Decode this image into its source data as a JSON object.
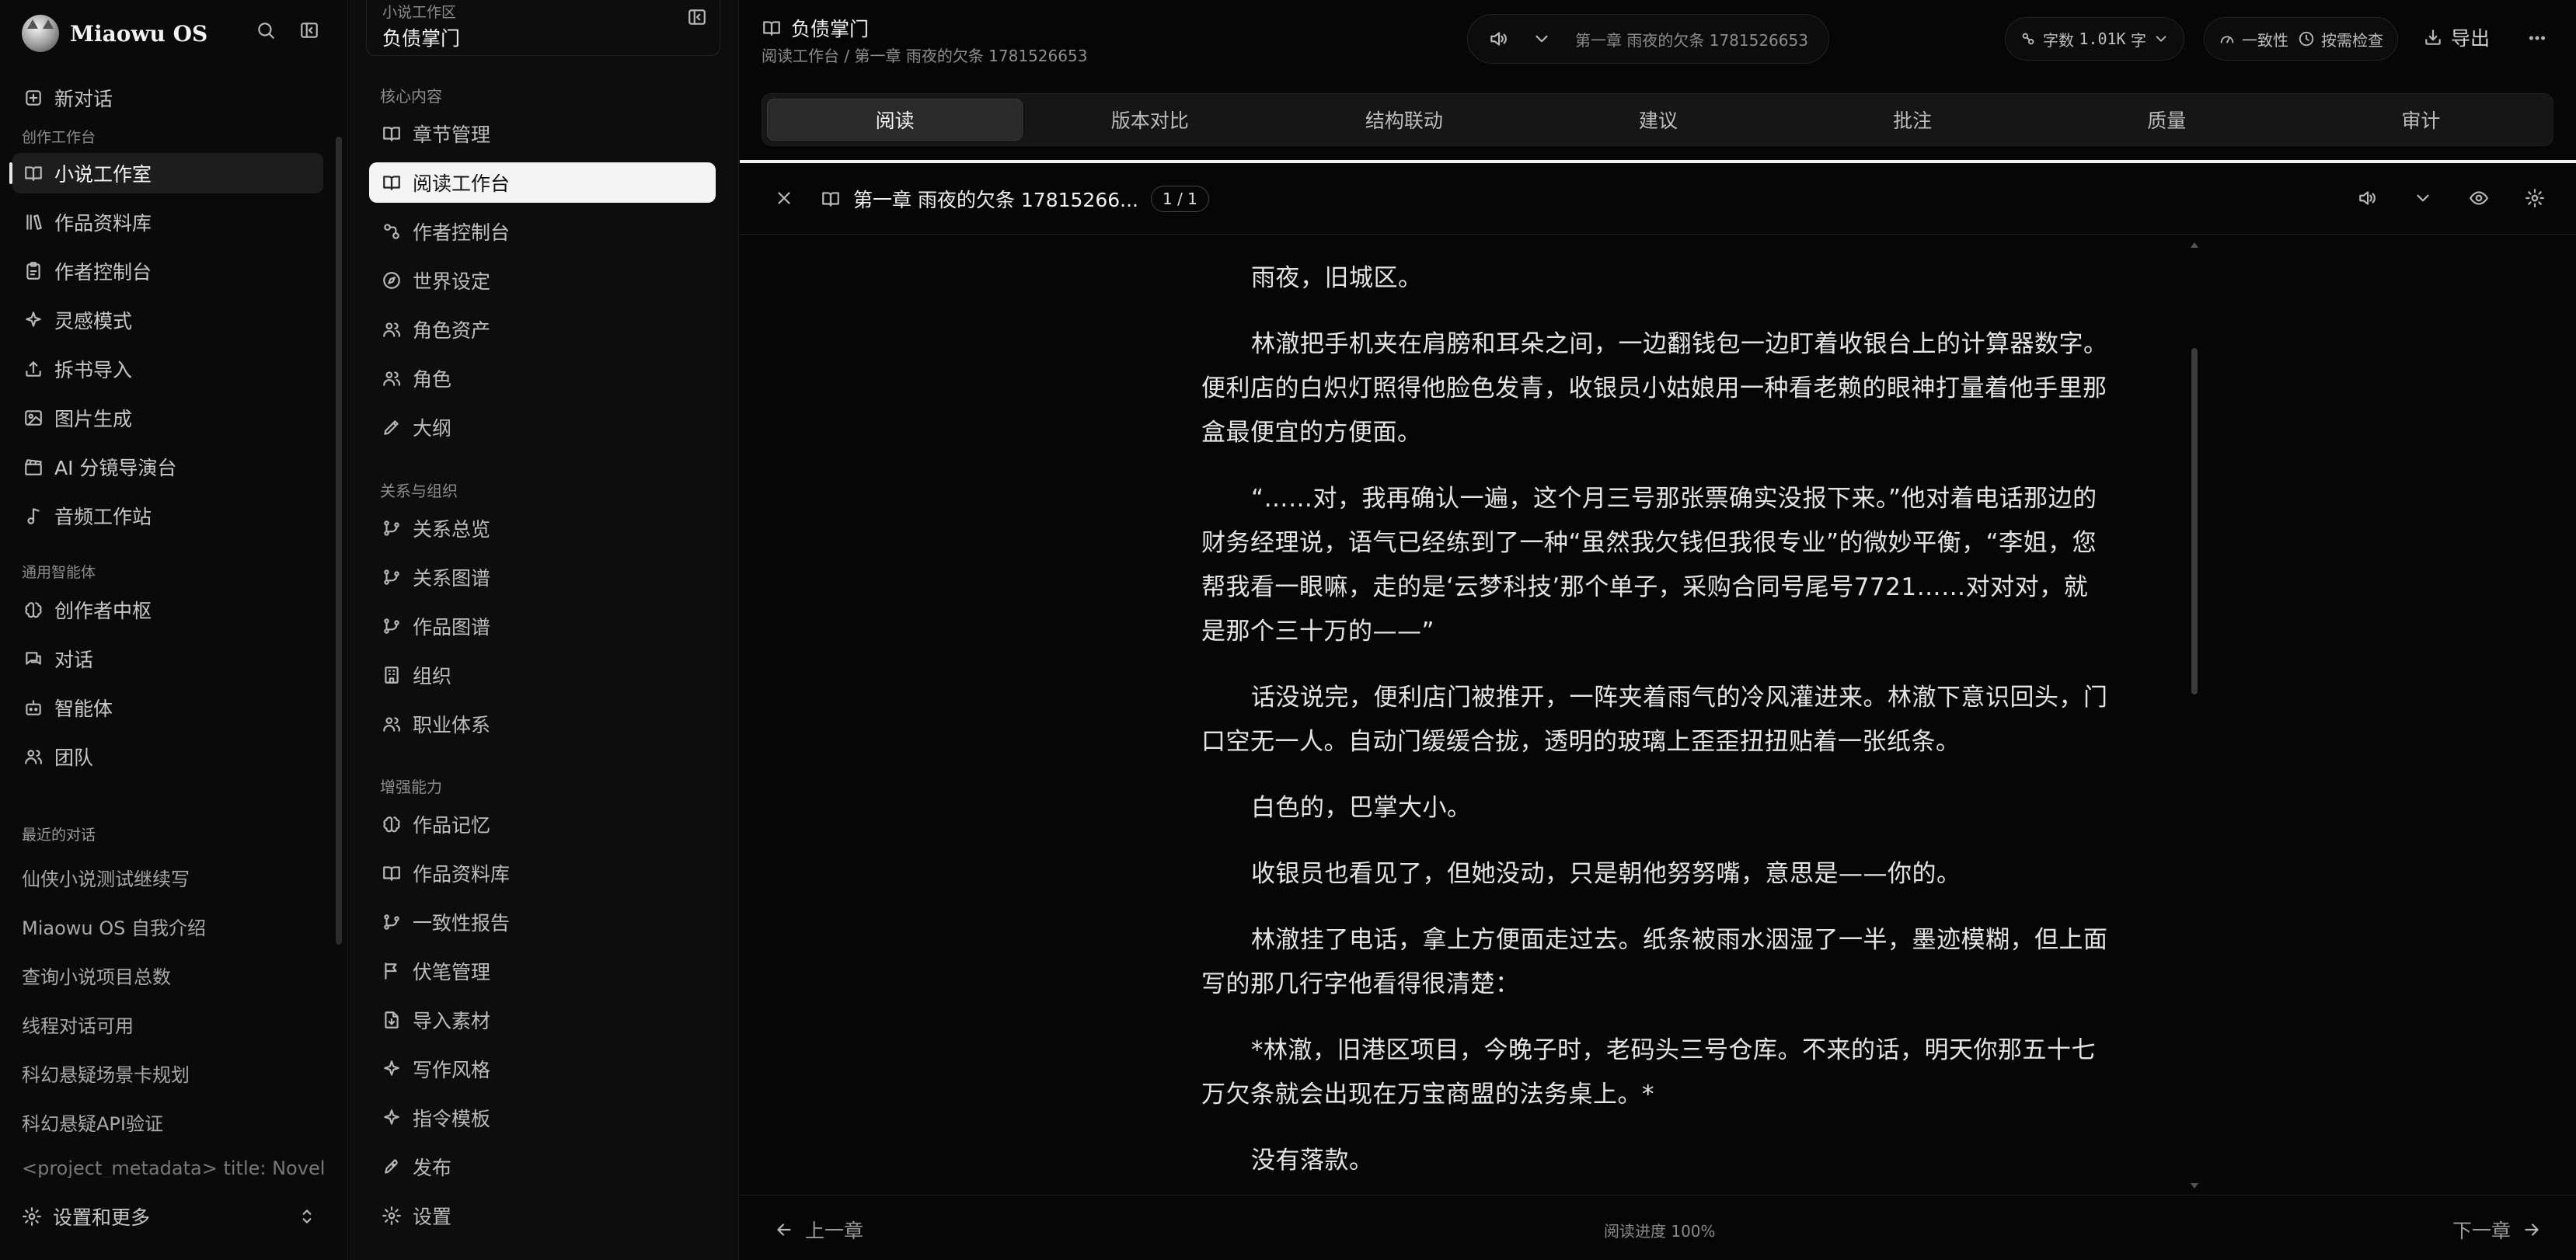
{
  "app": {
    "name": "Miaowu OS"
  },
  "sidebar": {
    "new_chat": "新对话",
    "section_create": "创作工作台",
    "create_items": [
      {
        "label": "小说工作室",
        "icon": "book-open-icon",
        "active": true
      },
      {
        "label": "作品资料库",
        "icon": "library-icon"
      },
      {
        "label": "作者控制台",
        "icon": "clipboard-icon"
      },
      {
        "label": "灵感模式",
        "icon": "sparkle-icon"
      },
      {
        "label": "拆书导入",
        "icon": "upload-icon"
      },
      {
        "label": "图片生成",
        "icon": "image-icon"
      },
      {
        "label": "AI 分镜导演台",
        "icon": "clapperboard-icon"
      },
      {
        "label": "音频工作站",
        "icon": "music-icon"
      }
    ],
    "section_agents": "通用智能体",
    "agent_items": [
      {
        "label": "创作者中枢",
        "icon": "brain-icon"
      },
      {
        "label": "对话",
        "icon": "chat-icon"
      },
      {
        "label": "智能体",
        "icon": "bot-icon"
      },
      {
        "label": "团队",
        "icon": "team-icon"
      }
    ],
    "section_recent": "最近的对话",
    "recent": [
      "仙侠小说测试继续写",
      "Miaowu OS 自我介绍",
      "查询小说项目总数",
      "线程对话可用",
      "科幻悬疑场景卡规划",
      "科幻悬疑API验证",
      "<project_metadata> title: Novel To..."
    ],
    "settings_label": "设置和更多"
  },
  "panel2": {
    "sub": "小说工作区",
    "title": "负债掌门",
    "section_core": "核心内容",
    "core_items": [
      {
        "label": "章节管理",
        "icon": "book-icon"
      },
      {
        "label": "阅读工作台",
        "icon": "book-open-icon",
        "active": true
      },
      {
        "label": "作者控制台",
        "icon": "nodes-icon"
      },
      {
        "label": "世界设定",
        "icon": "compass-icon"
      },
      {
        "label": "角色资产",
        "icon": "users-icon"
      },
      {
        "label": "角色",
        "icon": "users-icon"
      },
      {
        "label": "大纲",
        "icon": "pencil-icon"
      }
    ],
    "section_relations": "关系与组织",
    "relation_items": [
      {
        "label": "关系总览",
        "icon": "branch-icon"
      },
      {
        "label": "关系图谱",
        "icon": "branch-icon"
      },
      {
        "label": "作品图谱",
        "icon": "branch-icon"
      },
      {
        "label": "组织",
        "icon": "building-icon"
      },
      {
        "label": "职业体系",
        "icon": "users-icon"
      }
    ],
    "section_enhance": "增强能力",
    "enhance_items": [
      {
        "label": "作品记忆",
        "icon": "brain-icon"
      },
      {
        "label": "作品资料库",
        "icon": "book-icon"
      },
      {
        "label": "一致性报告",
        "icon": "branch-icon"
      },
      {
        "label": "伏笔管理",
        "icon": "flag-icon"
      },
      {
        "label": "导入素材",
        "icon": "file-import-icon"
      },
      {
        "label": "写作风格",
        "icon": "sparkle-icon"
      },
      {
        "label": "指令模板",
        "icon": "sparkle-icon"
      },
      {
        "label": "发布",
        "icon": "rocket-icon"
      },
      {
        "label": "设置",
        "icon": "gear-icon"
      }
    ]
  },
  "main": {
    "title": "负债掌门",
    "breadcrumb": [
      "阅读工作台",
      "第一章 雨夜的欠条 1781526653"
    ],
    "audio": {
      "chapter": "第一章 雨夜的欠条 1781526653"
    },
    "word_count": {
      "prefix": "字数",
      "value": "1.01K",
      "unit": "字"
    },
    "consistency": {
      "label": "一致性",
      "check": "按需检查"
    },
    "export_label": "导出",
    "tabs": [
      "阅读",
      "版本对比",
      "结构联动",
      "建议",
      "批注",
      "质量",
      "审计"
    ],
    "active_tab": 0,
    "reader": {
      "chapter_title": "第一章 雨夜的欠条 17815266...",
      "page_count": "1 / 1",
      "paragraphs": [
        "雨夜，旧城区。",
        "林澈把手机夹在肩膀和耳朵之间，一边翻钱包一边盯着收银台上的计算器数字。便利店的白炽灯照得他脸色发青，收银员小姑娘用一种看老赖的眼神打量着他手里那盒最便宜的方便面。",
        "“……对，我再确认一遍，这个月三号那张票确实没报下来。”他对着电话那边的财务经理说，语气已经练到了一种“虽然我欠钱但我很专业”的微妙平衡，“李姐，您帮我看一眼嘛，走的是‘云梦科技’那个单子，采购合同号尾号7721……对对对，就是那个三十万的——”",
        "话没说完，便利店门被推开，一阵夹着雨气的冷风灌进来。林澈下意识回头，门口空无一人。自动门缓缓合拢，透明的玻璃上歪歪扭扭贴着一张纸条。",
        "白色的，巴掌大小。",
        "收银员也看见了，但她没动，只是朝他努努嘴，意思是——你的。",
        "林澈挂了电话，拿上方便面走过去。纸条被雨水洇湿了一半，墨迹模糊，但上面写的那几行字他看得很清楚：",
        "*林澈，旧港区项目，今晚子时，老码头三号仓库。不来的话，明天你那五十七万欠条就会出现在万宝商盟的法务桌上。*",
        "没有落款。"
      ],
      "prev_label": "上一章",
      "progress_label": "阅读进度 100%",
      "progress": 1.0,
      "next_label": "下一章"
    }
  }
}
